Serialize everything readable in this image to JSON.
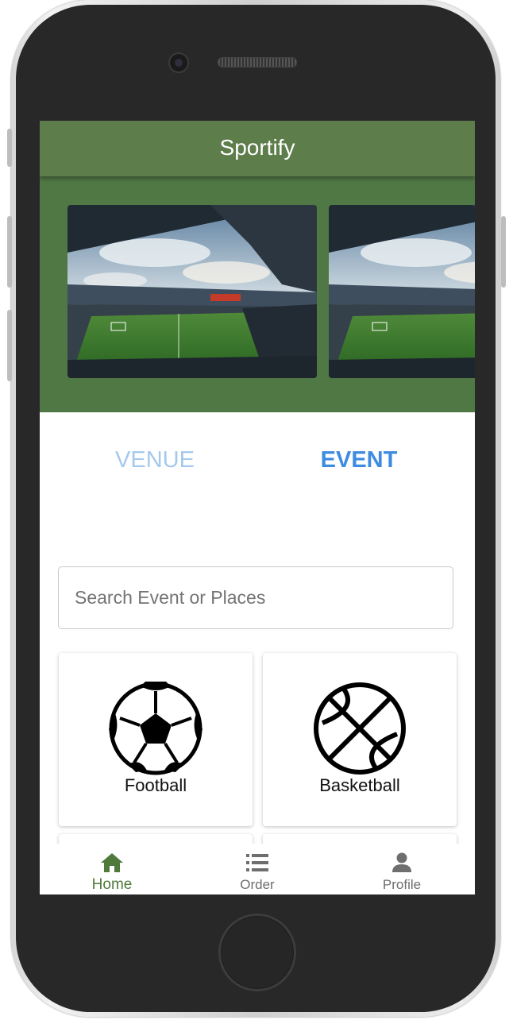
{
  "app": {
    "title": "Sportify"
  },
  "banner": {
    "slides": [
      {
        "image": "stadium-photo"
      },
      {
        "image": "stadium-photo"
      }
    ]
  },
  "tabs": [
    {
      "label": "VENUE",
      "active": false
    },
    {
      "label": "EVENT",
      "active": true
    }
  ],
  "search": {
    "placeholder": "Search Event or Places",
    "value": ""
  },
  "categories": [
    {
      "label": "Football",
      "icon": "football-icon"
    },
    {
      "label": "Basketball",
      "icon": "basketball-icon"
    },
    {
      "label": "",
      "icon": ""
    },
    {
      "label": "",
      "icon": ""
    }
  ],
  "bottom_nav": [
    {
      "label": "Home",
      "icon": "home-icon",
      "active": true
    },
    {
      "label": "Order",
      "icon": "list-icon",
      "active": false
    },
    {
      "label": "Profile",
      "icon": "person-icon",
      "active": false
    }
  ],
  "colors": {
    "app_bar": "#5d7d4b",
    "banner": "#507845",
    "active_tab": "#3e8ce0",
    "inactive_tab": "#a5c8ee",
    "nav_active": "#4f7a3c",
    "nav_inactive": "#6e6e6e"
  }
}
